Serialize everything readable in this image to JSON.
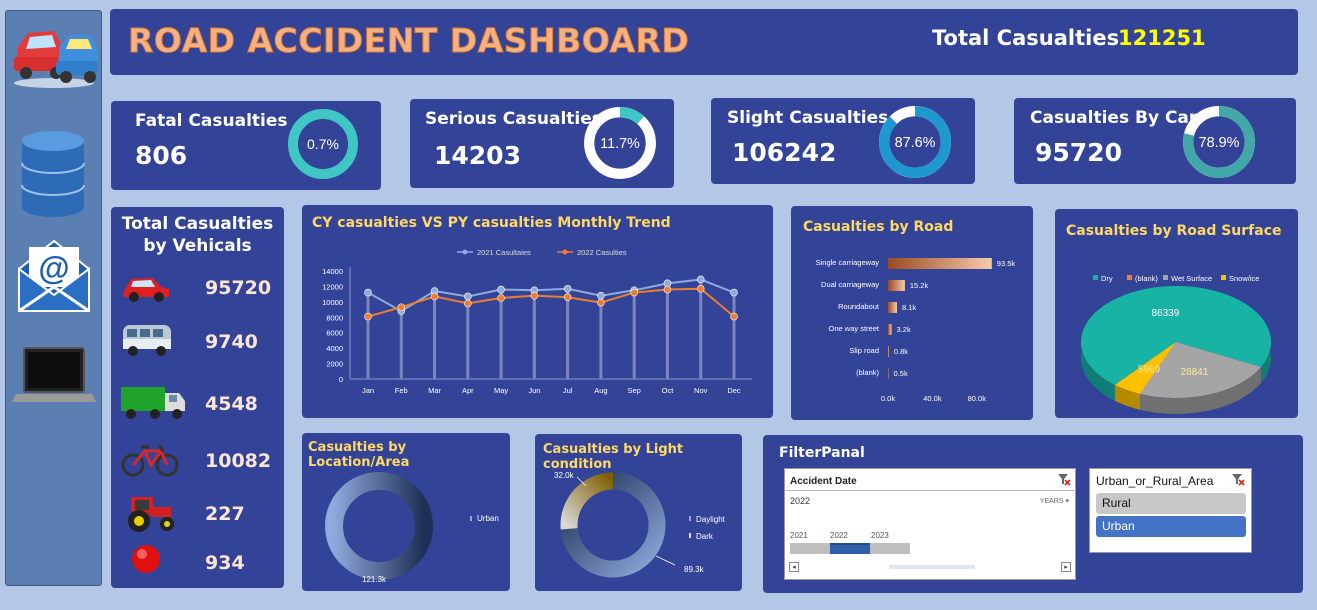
{
  "header": {
    "title": "ROAD ACCIDENT DASHBOARD",
    "total_label": "Total Casualties",
    "total_value": "121251"
  },
  "kpis": [
    {
      "title": "Fatal Casualties",
      "value": "806",
      "pct": "0.7%",
      "fraction": 0.007,
      "ring": "#41c6c6",
      "track": "#41c6c6"
    },
    {
      "title": "Serious Casualties",
      "value": "14203",
      "pct": "11.7%",
      "fraction": 0.117,
      "ring": "#ffffff",
      "track": "#41c6c6"
    },
    {
      "title": "Slight  Casualties",
      "value": "106242",
      "pct": "87.6%",
      "fraction": 0.876,
      "ring": "#ffffff",
      "track": "#1f97cf"
    },
    {
      "title": "Casualties By Car",
      "value": "95720",
      "pct": "78.9%",
      "fraction": 0.789,
      "ring": "#ffffff",
      "track": "#41a7a7"
    }
  ],
  "vehicles": {
    "title_line1": "Total Casualties",
    "title_line2": "by Vehicals",
    "items": [
      {
        "icon": "car-icon",
        "value": "95720"
      },
      {
        "icon": "van-icon",
        "value": "9740"
      },
      {
        "icon": "truck-icon",
        "value": "4548"
      },
      {
        "icon": "bicycle-icon",
        "value": "10082"
      },
      {
        "icon": "tractor-icon",
        "value": "227"
      },
      {
        "icon": "other-icon",
        "value": "934"
      }
    ]
  },
  "sidebar": {
    "icons": [
      "cars-icon",
      "database-icon",
      "email-icon",
      "laptop-icon"
    ]
  },
  "chart_data": [
    {
      "type": "line",
      "title": "CY casualties VS PY casualties Monthly Trend",
      "categories": [
        "Jan",
        "Feb",
        "Mar",
        "Apr",
        "May",
        "Jun",
        "Jul",
        "Aug",
        "Sep",
        "Oct",
        "Nov",
        "Dec"
      ],
      "series": [
        {
          "name": "2021 Casultaies",
          "color": "#8faadc",
          "values": [
            11200,
            8800,
            11400,
            10700,
            11600,
            11500,
            11700,
            10800,
            11500,
            12400,
            12900,
            11200
          ]
        },
        {
          "name": "2022 Casulties",
          "color": "#ed7d31",
          "values": [
            8100,
            9300,
            10700,
            9800,
            10500,
            10800,
            10600,
            9900,
            11200,
            11600,
            11700,
            8100
          ]
        }
      ],
      "yticks": [
        "0",
        "2000",
        "4000",
        "6000",
        "8000",
        "10000",
        "12000",
        "14000"
      ],
      "ylim": [
        0,
        14000
      ],
      "legend": "top"
    },
    {
      "type": "bar",
      "title": "Casualties by Road",
      "categories": [
        "Single carriageway",
        "Dual carriageway",
        "Roundabout",
        "One way street",
        "Slip road",
        "(blank)"
      ],
      "values": [
        93.5,
        15.2,
        8.1,
        3.2,
        0.8,
        0.5
      ],
      "labels": [
        "93.5k",
        "15.2k",
        "8.1k",
        "3.2k",
        "0.8k",
        "0.5k"
      ],
      "xticks": [
        "0.0k",
        "40.0k",
        "80.0k"
      ],
      "xlim": [
        0,
        100
      ]
    },
    {
      "type": "pie",
      "title": "Casualties by Road Surface",
      "legend": [
        "Dry",
        "(blank)",
        "Wet Surface",
        "Snow/ice"
      ],
      "colors": [
        "#19b3a6",
        "#ed7d31",
        "#a5a5a5",
        "#ffc000"
      ],
      "values": [
        86339,
        0,
        28841,
        5969
      ],
      "labels": [
        "86339",
        "",
        "28841",
        "5969"
      ]
    },
    {
      "type": "pie",
      "title": "Casualties by Location/Area",
      "legend": [
        "Urban"
      ],
      "values": [
        121.3
      ],
      "labels": [
        "121.3k"
      ]
    },
    {
      "type": "pie",
      "title": "Casualties by Light condition",
      "legend": [
        "Daylight",
        "Dark"
      ],
      "values": [
        89.3,
        32.0
      ],
      "labels": [
        "89.3k",
        "32.0k"
      ]
    }
  ],
  "filter": {
    "title": "FilterPanal",
    "date": {
      "label": "Accident Date",
      "selected": "2022",
      "mode": "YEARS",
      "years": [
        "2021",
        "2022",
        "2023"
      ]
    },
    "area": {
      "label": "Urban_or_Rural_Area",
      "options": [
        "Rural",
        "Urban"
      ],
      "selected": "Urban"
    }
  }
}
